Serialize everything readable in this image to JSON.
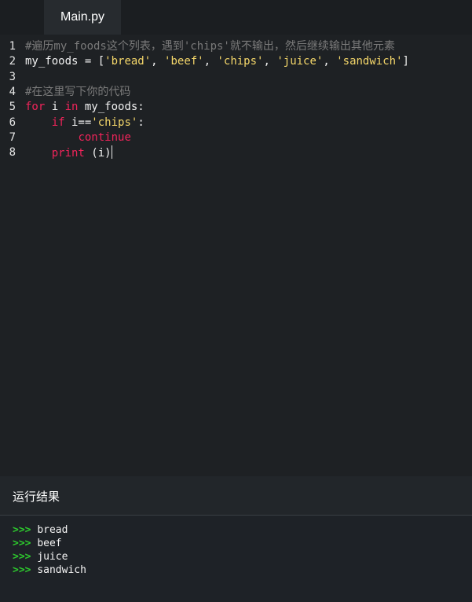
{
  "tabs": [
    {
      "label": "Main.py"
    }
  ],
  "editor": {
    "lines": [
      {
        "num": "1",
        "tokens": [
          {
            "t": "#遍历my_foods这个列表，遇到'chips'就不输出，然后继续输出其他元素",
            "k": "comment"
          }
        ]
      },
      {
        "num": "2",
        "tokens": [
          {
            "t": "my_foods = [",
            "k": "plain"
          },
          {
            "t": "'bread'",
            "k": "str"
          },
          {
            "t": ", ",
            "k": "plain"
          },
          {
            "t": "'beef'",
            "k": "str"
          },
          {
            "t": ", ",
            "k": "plain"
          },
          {
            "t": "'chips'",
            "k": "str"
          },
          {
            "t": ", ",
            "k": "plain"
          },
          {
            "t": "'juice'",
            "k": "str"
          },
          {
            "t": ", ",
            "k": "plain"
          },
          {
            "t": "'sandwich'",
            "k": "str"
          },
          {
            "t": "]",
            "k": "plain"
          }
        ]
      },
      {
        "num": "3",
        "tokens": []
      },
      {
        "num": "4",
        "tokens": [
          {
            "t": "#在这里写下你的代码",
            "k": "comment"
          }
        ]
      },
      {
        "num": "5",
        "tokens": [
          {
            "t": "for",
            "k": "kw"
          },
          {
            "t": " i ",
            "k": "plain"
          },
          {
            "t": "in",
            "k": "kw"
          },
          {
            "t": " my_foods:",
            "k": "plain"
          }
        ]
      },
      {
        "num": "6",
        "tokens": [
          {
            "t": "    ",
            "k": "plain"
          },
          {
            "t": "if",
            "k": "kw"
          },
          {
            "t": " i==",
            "k": "plain"
          },
          {
            "t": "'chips'",
            "k": "str"
          },
          {
            "t": ":",
            "k": "plain"
          }
        ]
      },
      {
        "num": "7",
        "tokens": [
          {
            "t": "        ",
            "k": "plain"
          },
          {
            "t": "continue",
            "k": "kw"
          }
        ]
      },
      {
        "num": "8",
        "tokens": [
          {
            "t": "    ",
            "k": "plain"
          },
          {
            "t": "print",
            "k": "kw"
          },
          {
            "t": " (i)",
            "k": "plain"
          }
        ],
        "cursor": true
      }
    ]
  },
  "output": {
    "title": "运行结果",
    "prompt": ">>>",
    "lines": [
      "bread",
      "beef",
      "juice",
      "sandwich"
    ]
  },
  "colors": {
    "keyword": "#f0245a",
    "string": "#f5d76a",
    "comment": "#7a7a7a",
    "prompt": "#2dc82d"
  }
}
